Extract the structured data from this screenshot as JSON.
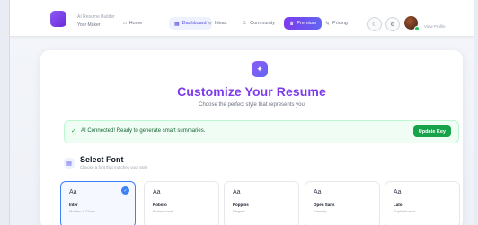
{
  "nav": {
    "brand_name": "AI Resume Builder",
    "brand_sub": "Your Maker",
    "items": [
      {
        "icon": "home-icon",
        "glyph": "⌂",
        "label": "Home"
      },
      {
        "icon": "grid-icon",
        "glyph": "▦",
        "label": "Dashboard"
      },
      {
        "icon": "bulb-icon",
        "glyph": "✧",
        "label": "Ideas"
      },
      {
        "icon": "people-icon",
        "glyph": "☺",
        "label": "Community"
      },
      {
        "icon": "crown-icon",
        "glyph": "♛",
        "label": "Premium"
      },
      {
        "icon": "tag-icon",
        "glyph": "✎",
        "label": "Pricing"
      }
    ],
    "profile_label": "View Profile"
  },
  "hero": {
    "title": "Customize Your Resume",
    "subtitle": "Choose the perfect style that represents you"
  },
  "banner": {
    "text": "AI Connected! Ready to generate smart summaries.",
    "button": "Update Key",
    "color": "#16a34a"
  },
  "font_section": {
    "title": "Select Font",
    "subtitle": "Choose a font that matches your style",
    "fonts": [
      {
        "sample": "Aa",
        "name": "Inter",
        "desc": "Modern & Clean",
        "selected": true
      },
      {
        "sample": "Aa",
        "name": "Roboto",
        "desc": "Professional",
        "selected": false
      },
      {
        "sample": "Aa",
        "name": "Poppins",
        "desc": "Elegant",
        "selected": false
      },
      {
        "sample": "Aa",
        "name": "Open Sans",
        "desc": "Friendly",
        "selected": false
      },
      {
        "sample": "Aa",
        "name": "Lato",
        "desc": "Sophisticated",
        "selected": false
      }
    ]
  },
  "colors": {
    "accent": "#7c3aed",
    "selected_border": "#3b82f6"
  }
}
